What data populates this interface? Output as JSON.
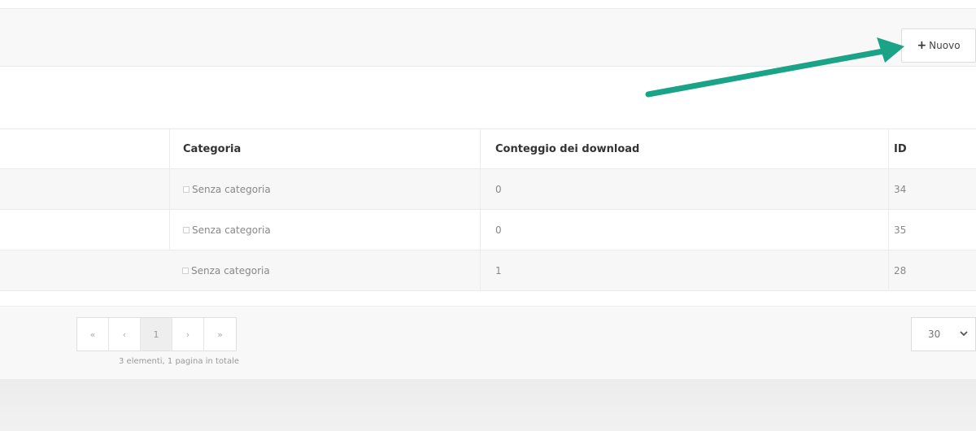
{
  "toolbar": {
    "new_button_label": "Nuovo",
    "new_button_icon": "plus-icon"
  },
  "annotation": {
    "arrow_color": "#1aa387",
    "arrow_icon": "arrow-annotation-icon"
  },
  "table": {
    "headers": {
      "category": "Categoria",
      "download_count": "Conteggio dei download",
      "id": "ID"
    },
    "rows": [
      {
        "category": "Senza categoria",
        "download_count": "0",
        "id": "34"
      },
      {
        "category": "Senza categoria",
        "download_count": "0",
        "id": "35"
      },
      {
        "category": "Senza categoria",
        "download_count": "1",
        "id": "28"
      }
    ]
  },
  "pagination": {
    "first": "«",
    "prev": "‹",
    "current_page": "1",
    "next": "›",
    "last": "»",
    "summary": "3 elementi, 1 pagina in totale"
  },
  "per_page": {
    "selected": "30"
  }
}
